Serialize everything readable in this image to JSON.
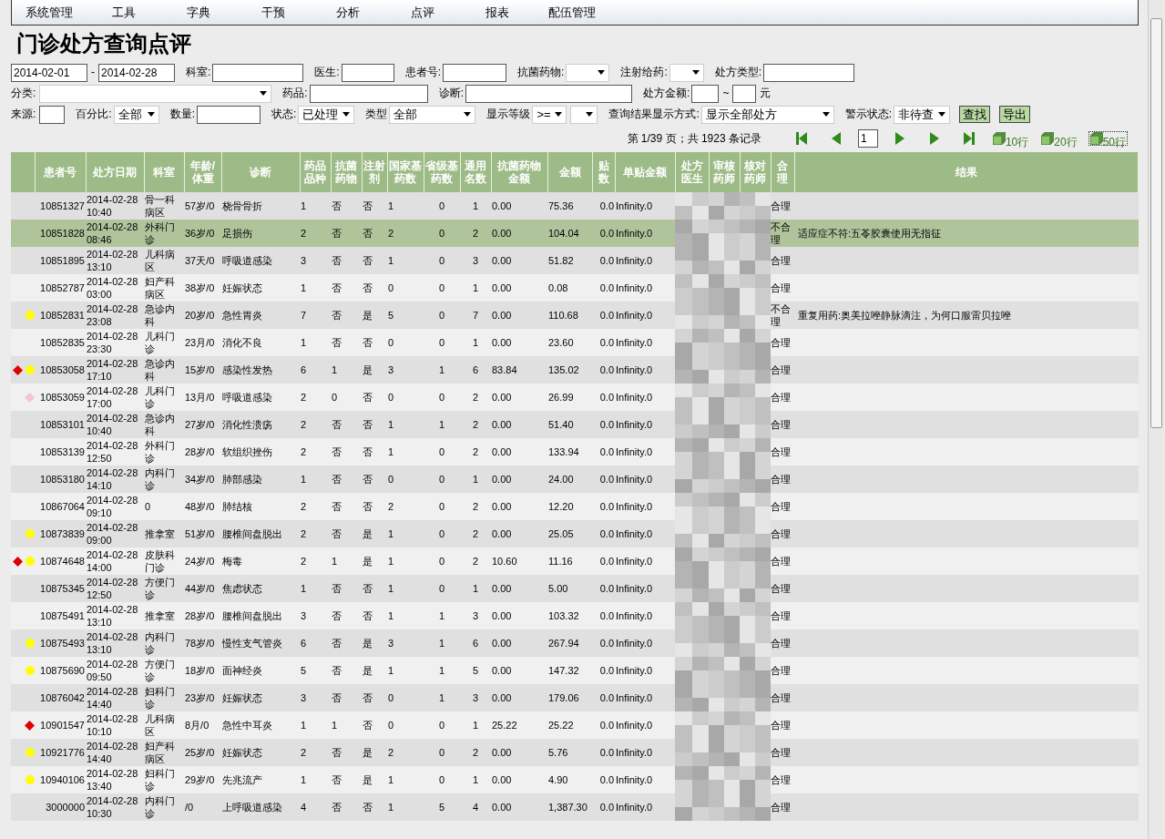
{
  "menu": [
    "系统管理",
    "工具",
    "字典",
    "干预",
    "分析",
    "点评",
    "报表",
    "配伍管理"
  ],
  "title": "门诊处方查询点评",
  "filters": [
    [
      {
        "kind": "input",
        "value": "2014-02-01"
      },
      {
        "kind": "label",
        "text": "-"
      },
      {
        "kind": "input",
        "value": "2014-02-28"
      },
      {
        "kind": "label",
        "text": "科室:"
      },
      {
        "kind": "input"
      },
      {
        "kind": "label",
        "text": "医生:"
      },
      {
        "kind": "input"
      },
      {
        "kind": "label",
        "text": "患者号:"
      },
      {
        "kind": "input"
      },
      {
        "kind": "label",
        "text": "抗菌药物:"
      },
      {
        "kind": "select"
      },
      {
        "kind": "label",
        "text": "注射给药:"
      },
      {
        "kind": "select"
      },
      {
        "kind": "label",
        "text": "处方类型:"
      },
      {
        "kind": "input"
      }
    ],
    [
      {
        "kind": "label",
        "text": "分类:"
      },
      {
        "kind": "select"
      },
      {
        "kind": "label",
        "text": "药品:"
      },
      {
        "kind": "input"
      },
      {
        "kind": "label",
        "text": "诊断:"
      },
      {
        "kind": "input"
      },
      {
        "kind": "label",
        "text": "处方金额:"
      },
      {
        "kind": "input"
      },
      {
        "kind": "label",
        "text": "~"
      },
      {
        "kind": "input"
      },
      {
        "kind": "label",
        "text": "元"
      }
    ],
    [
      {
        "kind": "label",
        "text": "来源:"
      },
      {
        "kind": "input"
      },
      {
        "kind": "label",
        "text": "百分比:"
      },
      {
        "kind": "select",
        "value": "全部"
      },
      {
        "kind": "label",
        "text": "数量:"
      },
      {
        "kind": "input"
      },
      {
        "kind": "label",
        "text": "状态:"
      },
      {
        "kind": "select",
        "value": "已处理"
      },
      {
        "kind": "label",
        "text": "类型"
      },
      {
        "kind": "select",
        "value": "全部"
      },
      {
        "kind": "label",
        "text": "显示等级"
      },
      {
        "kind": "select",
        "value": ">="
      },
      {
        "kind": "select"
      },
      {
        "kind": "label",
        "text": "查询结果显示方式:"
      },
      {
        "kind": "select",
        "value": "显示全部处方"
      },
      {
        "kind": "label",
        "text": "警示状态:"
      },
      {
        "kind": "select",
        "value": "非待查"
      },
      {
        "kind": "button",
        "text": "查找"
      },
      {
        "kind": "button",
        "text": "导出"
      }
    ]
  ],
  "pagination": {
    "summary": "第 1/39 页；共 1923 条记录",
    "page": "1",
    "page_sizes": [
      {
        "label": "10行",
        "selected": false
      },
      {
        "label": "20行",
        "selected": false
      },
      {
        "label": "50行",
        "selected": true
      }
    ]
  },
  "table": {
    "columns": [
      {
        "label": "患者号",
        "kind": "text"
      },
      {
        "label": "处方日期",
        "kind": "text"
      },
      {
        "label": "科室",
        "kind": "text"
      },
      {
        "label": "年龄/体重",
        "kind": "text"
      },
      {
        "label": "诊断",
        "kind": "text"
      },
      {
        "label": "药品品种",
        "kind": "text"
      },
      {
        "label": "抗菌药物",
        "kind": "text"
      },
      {
        "label": "注射剂",
        "kind": "text"
      },
      {
        "label": "国家基药数",
        "kind": "text"
      },
      {
        "label": "省级基药数",
        "kind": "text"
      },
      {
        "label": "通用名数",
        "kind": "text"
      },
      {
        "label": "抗菌药物金额",
        "kind": "text"
      },
      {
        "label": "金额",
        "kind": "text"
      },
      {
        "label": "贴数",
        "kind": "text"
      },
      {
        "label": "单贴金额",
        "kind": "text"
      },
      {
        "label": "处方医生",
        "kind": "redacted"
      },
      {
        "label": "审核药师",
        "kind": "redacted"
      },
      {
        "label": "核对药师",
        "kind": "redacted"
      },
      {
        "label": "合理",
        "kind": "verdict"
      },
      {
        "label": "结果",
        "kind": "result"
      }
    ],
    "rows": [
      {
        "selected": false,
        "cells": [
          "10851327",
          "2014-02-28 10:40",
          "骨一科病区",
          "57岁/0",
          "桡骨骨折",
          "1",
          "否",
          "否",
          "1",
          "0",
          "1",
          "0.00",
          "75.36",
          "0.0",
          "Infinity.0"
        ],
        "verdict": "合理"
      },
      {
        "selected": true,
        "cells": [
          "10851828",
          "2014-02-28 08:46",
          "外科门诊",
          "36岁/0",
          "足损伤",
          "2",
          "否",
          "否",
          "2",
          "0",
          "2",
          "0.00",
          "104.04",
          "0.0",
          "Infinity.0"
        ],
        "verdict": "不合理",
        "result": "适应症不符:五苓胶囊使用无指征"
      },
      {
        "selected": false,
        "cells": [
          "10851895",
          "2014-02-28 13:10",
          "儿科病区",
          "37天/0",
          "呼吸道感染",
          "3",
          "否",
          "否",
          "1",
          "0",
          "3",
          "0.00",
          "51.82",
          "0.0",
          "Infinity.0"
        ],
        "verdict": "合理"
      },
      {
        "selected": false,
        "cells": [
          "10852787",
          "2014-02-28 03:00",
          "妇产科病区",
          "38岁/0",
          "妊娠状态",
          "1",
          "否",
          "否",
          "0",
          "0",
          "1",
          "0.00",
          "0.08",
          "0.0",
          "Infinity.0"
        ],
        "verdict": "合理"
      },
      {
        "selected": false,
        "marks": [
          {
            "kind": "dot",
            "color": "#ffff00"
          }
        ],
        "cells": [
          "10852831",
          "2014-02-28 23:08",
          "急诊内科",
          "20岁/0",
          "急性胃炎",
          "7",
          "否",
          "是",
          "5",
          "0",
          "7",
          "0.00",
          "110.68",
          "0.0",
          "Infinity.0"
        ],
        "verdict": "不合理",
        "result": "重复用药:奥美拉唑静脉滴注，为何口服雷贝拉唑"
      },
      {
        "selected": false,
        "cells": [
          "10852835",
          "2014-02-28 23:30",
          "儿科门诊",
          "23月/0",
          "消化不良",
          "1",
          "否",
          "否",
          "0",
          "0",
          "1",
          "0.00",
          "23.60",
          "0.0",
          "Infinity.0"
        ],
        "verdict": "合理"
      },
      {
        "selected": false,
        "marks": [
          {
            "kind": "diamond",
            "color": "#e00000"
          },
          {
            "kind": "dot",
            "color": "#ffff00"
          }
        ],
        "cells": [
          "10853058",
          "2014-02-28 17:10",
          "急诊内科",
          "15岁/0",
          "感染性发热",
          "6",
          "1",
          "是",
          "3",
          "1",
          "6",
          "83.84",
          "135.02",
          "0.0",
          "Infinity.0"
        ],
        "verdict": "合理"
      },
      {
        "selected": false,
        "marks": [
          {
            "kind": "diamond",
            "color": "#f4c4d0"
          }
        ],
        "cells": [
          "10853059",
          "2014-02-28 17:00",
          "儿科门诊",
          "13月/0",
          "呼吸道感染",
          "2",
          "0",
          "否",
          "0",
          "0",
          "2",
          "0.00",
          "26.99",
          "0.0",
          "Infinity.0"
        ],
        "verdict": "合理"
      },
      {
        "selected": false,
        "cells": [
          "10853101",
          "2014-02-28 10:40",
          "急诊内科",
          "27岁/0",
          "消化性溃疡",
          "2",
          "否",
          "否",
          "1",
          "1",
          "2",
          "0.00",
          "51.40",
          "0.0",
          "Infinity.0"
        ],
        "verdict": "合理"
      },
      {
        "selected": false,
        "cells": [
          "10853139",
          "2014-02-28 12:50",
          "外科门诊",
          "28岁/0",
          "软组织挫伤",
          "2",
          "否",
          "否",
          "1",
          "0",
          "2",
          "0.00",
          "133.94",
          "0.0",
          "Infinity.0"
        ],
        "verdict": "合理"
      },
      {
        "selected": false,
        "cells": [
          "10853180",
          "2014-02-28 14:10",
          "内科门诊",
          "34岁/0",
          "肺部感染",
          "1",
          "否",
          "否",
          "0",
          "0",
          "1",
          "0.00",
          "24.00",
          "0.0",
          "Infinity.0"
        ],
        "verdict": "合理"
      },
      {
        "selected": false,
        "cells": [
          "10867064",
          "2014-02-28 09:10",
          "0",
          "48岁/0",
          "肺结核",
          "2",
          "否",
          "否",
          "2",
          "0",
          "2",
          "0.00",
          "12.20",
          "0.0",
          "Infinity.0"
        ],
        "verdict": "合理"
      },
      {
        "selected": false,
        "marks": [
          {
            "kind": "dot",
            "color": "#ffff00"
          }
        ],
        "cells": [
          "10873839",
          "2014-02-28 09:00",
          "推拿室",
          "51岁/0",
          "腰椎间盘脱出",
          "2",
          "否",
          "是",
          "1",
          "0",
          "2",
          "0.00",
          "25.05",
          "0.0",
          "Infinity.0"
        ],
        "verdict": "合理"
      },
      {
        "selected": false,
        "marks": [
          {
            "kind": "diamond",
            "color": "#e00000"
          },
          {
            "kind": "dot",
            "color": "#ffff00"
          }
        ],
        "cells": [
          "10874648",
          "2014-02-28 14:00",
          "皮肤科门诊",
          "24岁/0",
          "梅毒",
          "2",
          "1",
          "是",
          "1",
          "0",
          "2",
          "10.60",
          "11.16",
          "0.0",
          "Infinity.0"
        ],
        "verdict": "合理"
      },
      {
        "selected": false,
        "cells": [
          "10875345",
          "2014-02-28 12:50",
          "方便门诊",
          "44岁/0",
          "焦虑状态",
          "1",
          "否",
          "否",
          "1",
          "0",
          "1",
          "0.00",
          "5.00",
          "0.0",
          "Infinity.0"
        ],
        "verdict": "合理"
      },
      {
        "selected": false,
        "cells": [
          "10875491",
          "2014-02-28 13:10",
          "推拿室",
          "28岁/0",
          "腰椎间盘脱出",
          "3",
          "否",
          "否",
          "1",
          "1",
          "3",
          "0.00",
          "103.32",
          "0.0",
          "Infinity.0"
        ],
        "verdict": "合理"
      },
      {
        "selected": false,
        "marks": [
          {
            "kind": "dot",
            "color": "#ffff00"
          }
        ],
        "cells": [
          "10875493",
          "2014-02-28 13:10",
          "内科门诊",
          "78岁/0",
          "慢性支气管炎",
          "6",
          "否",
          "是",
          "3",
          "1",
          "6",
          "0.00",
          "267.94",
          "0.0",
          "Infinity.0"
        ],
        "verdict": "合理"
      },
      {
        "selected": false,
        "marks": [
          {
            "kind": "dot",
            "color": "#ffff00"
          }
        ],
        "cells": [
          "10875690",
          "2014-02-28 09:50",
          "方便门诊",
          "18岁/0",
          "面神经炎",
          "5",
          "否",
          "是",
          "1",
          "1",
          "5",
          "0.00",
          "147.32",
          "0.0",
          "Infinity.0"
        ],
        "verdict": "合理"
      },
      {
        "selected": false,
        "cells": [
          "10876042",
          "2014-02-28 14:40",
          "妇科门诊",
          "23岁/0",
          "妊娠状态",
          "3",
          "否",
          "否",
          "0",
          "1",
          "3",
          "0.00",
          "179.06",
          "0.0",
          "Infinity.0"
        ],
        "verdict": "合理"
      },
      {
        "selected": false,
        "marks": [
          {
            "kind": "diamond",
            "color": "#e00000"
          }
        ],
        "cells": [
          "10901547",
          "2014-02-28 10:10",
          "儿科病区",
          "8月/0",
          "急性中耳炎",
          "1",
          "1",
          "否",
          "0",
          "0",
          "1",
          "25.22",
          "25.22",
          "0.0",
          "Infinity.0"
        ],
        "verdict": "合理"
      },
      {
        "selected": false,
        "marks": [
          {
            "kind": "dot",
            "color": "#ffff00"
          }
        ],
        "cells": [
          "10921776",
          "2014-02-28 14:40",
          "妇产科病区",
          "25岁/0",
          "妊娠状态",
          "2",
          "否",
          "是",
          "2",
          "0",
          "2",
          "0.00",
          "5.76",
          "0.0",
          "Infinity.0"
        ],
        "verdict": "合理"
      },
      {
        "selected": false,
        "marks": [
          {
            "kind": "dot",
            "color": "#ffff00"
          }
        ],
        "cells": [
          "10940106",
          "2014-02-28 13:40",
          "妇科门诊",
          "29岁/0",
          "先兆流产",
          "1",
          "否",
          "是",
          "1",
          "0",
          "1",
          "0.00",
          "4.90",
          "0.0",
          "Infinity.0"
        ],
        "verdict": "合理"
      },
      {
        "selected": false,
        "cells": [
          "3000000",
          "2014-02-28 10:30",
          "内科门诊",
          "/0",
          "上呼吸道感染",
          "4",
          "否",
          "否",
          "1",
          "5",
          "4",
          "0.00",
          "1,387.30",
          "0.0",
          "Infinity.0"
        ],
        "verdict": "合理"
      }
    ]
  }
}
